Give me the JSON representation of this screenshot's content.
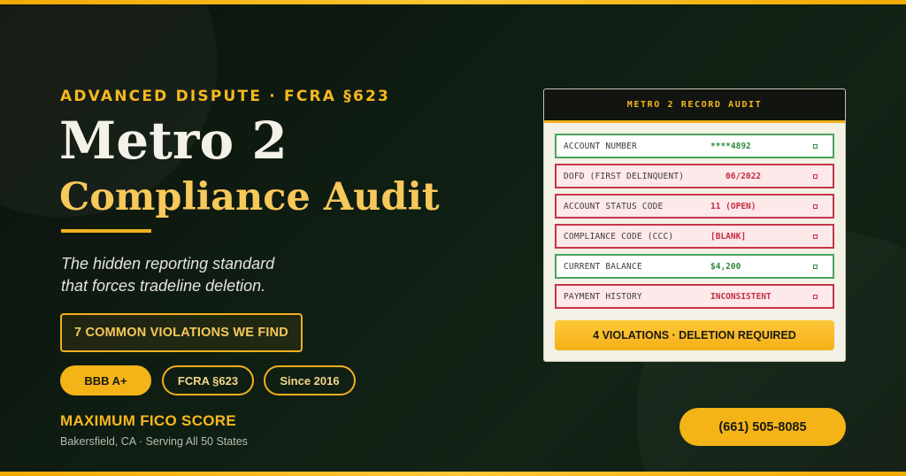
{
  "hero": {
    "eyebrow": "ADVANCED DISPUTE · FCRA §623",
    "title_line1": "Metro 2",
    "title_line2": "Compliance Audit",
    "subtitle_line1": "The hidden reporting standard",
    "subtitle_line2": "that forces tradeline deletion.",
    "cta_label": "7 COMMON VIOLATIONS WE FIND"
  },
  "badges": [
    "BBB A+",
    "FCRA §623",
    "Since 2016"
  ],
  "brand": {
    "name": "MAXIMUM FICO SCORE",
    "location": "Bakersfield, CA · Serving All 50 States",
    "phone": "(661) 505-8085"
  },
  "audit": {
    "header": "METRO 2 RECORD AUDIT",
    "rows": [
      {
        "label": "ACCOUNT NUMBER",
        "value": "****4892",
        "status": "ok"
      },
      {
        "label": "DOFD (FIRST DELINQUENT)",
        "value": "06/2022",
        "status": "bad"
      },
      {
        "label": "ACCOUNT STATUS CODE",
        "value": "11 (OPEN)",
        "status": "bad"
      },
      {
        "label": "COMPLIANCE CODE (CCC)",
        "value": "[BLANK]",
        "status": "bad"
      },
      {
        "label": "CURRENT BALANCE",
        "value": "$4,200",
        "status": "ok"
      },
      {
        "label": "PAYMENT HISTORY",
        "value": "INCONSISTENT",
        "status": "bad"
      }
    ],
    "footer": "4 VIOLATIONS · DELETION REQUIRED"
  },
  "colors": {
    "accent": "#f4b417",
    "background": "#0c1a0f",
    "ok": "#2e8a3e",
    "violation": "#c42d40"
  }
}
